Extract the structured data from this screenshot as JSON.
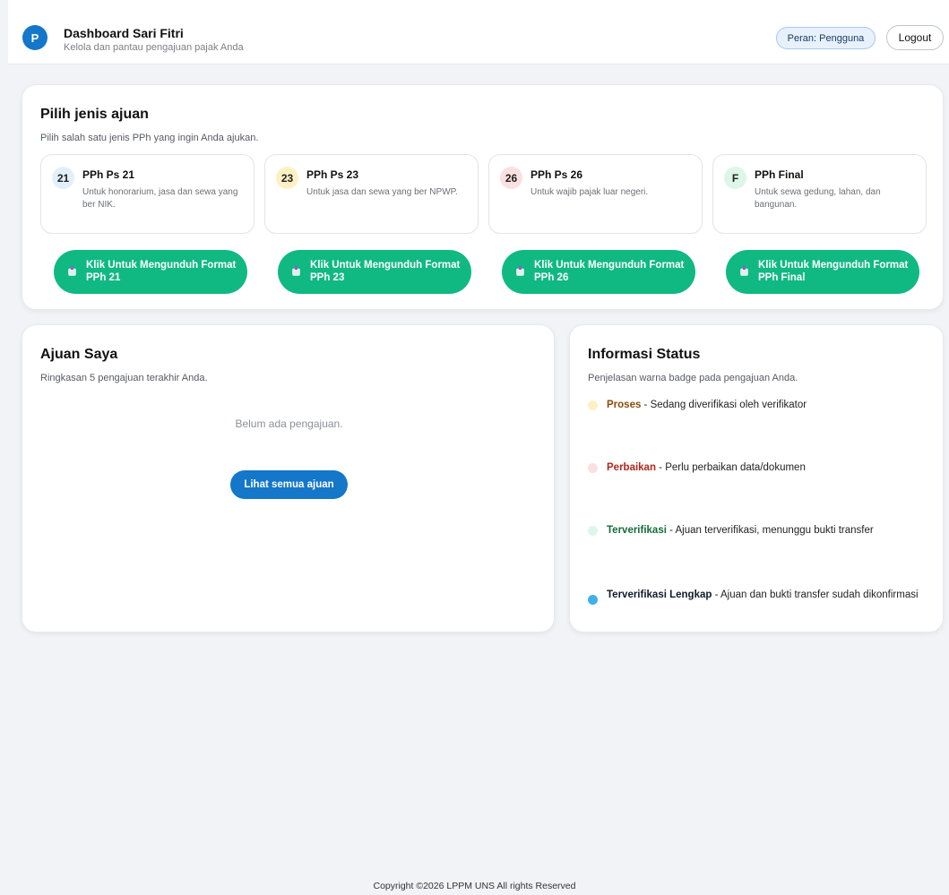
{
  "header": {
    "avatar_letter": "P",
    "title": "Dashboard Sari Fitri",
    "subtitle": "Kelola dan pantau pengajuan pajak Anda",
    "role_badge": "Peran: Pengguna",
    "logout_label": "Logout"
  },
  "pilih": {
    "title": "Pilih jenis ajuan",
    "subtitle": "Pilih salah satu jenis PPh yang ingin Anda ajukan.",
    "types": [
      {
        "badge": "21",
        "name": "PPh Ps 21",
        "desc": "Untuk honorarium, jasa dan sewa yang ber NIK.",
        "badge_color": "#e3f0fb"
      },
      {
        "badge": "23",
        "name": "PPh Ps 23",
        "desc": "Untuk jasa dan sewa yang ber NPWP.",
        "badge_color": "#fdf1c4"
      },
      {
        "badge": "26",
        "name": "PPh Ps 26",
        "desc": "Untuk wajib pajak luar negeri.",
        "badge_color": "#fbe0e0"
      },
      {
        "badge": "F",
        "name": "PPh Final",
        "desc": "Untuk sewa gedung, lahan, dan bangunan.",
        "badge_color": "#ddf6e8"
      }
    ],
    "downloads": [
      {
        "label": "Klik Untuk Mengunduh Format PPh 21",
        "icon": "document-download-icon"
      },
      {
        "label": "Klik Untuk Mengunduh Format PPh 23",
        "icon": "document-download-icon"
      },
      {
        "label": "Klik Untuk Mengunduh Format PPh 26",
        "icon": "document-download-icon"
      },
      {
        "label": "Klik Untuk Mengunduh Format PPh Final",
        "icon": "document-download-icon"
      }
    ],
    "download_color": "#10b981"
  },
  "ajuan": {
    "title": "Ajuan Saya",
    "subtitle": "Ringkasan 5 pengajuan terakhir Anda.",
    "empty_text": "Belum ada pengajuan.",
    "see_all_label": "Lihat semua ajuan"
  },
  "info": {
    "title": "Informasi Status",
    "subtitle": "Penjelasan warna badge pada pengajuan Anda.",
    "statuses": [
      {
        "label": "Proses",
        "desc": " - Sedang diverifikasi oleh verifikator",
        "dot_color": "#fdf1c4",
        "label_color": "#8a4b0a"
      },
      {
        "label": "Perbaikan",
        "desc": " - Perlu perbaikan data/dokumen",
        "dot_color": "#fbe0e0",
        "label_color": "#b3261e"
      },
      {
        "label": "Terverifikasi",
        "desc": " - Ajuan terverifikasi, menunggu bukti transfer",
        "dot_color": "#ddf6e8",
        "label_color": "#156b3a"
      },
      {
        "label": "Terverifikasi Lengkap",
        "desc": " - Ajuan dan bukti transfer sudah dikonfirmasi",
        "dot_color": "#3fb0ea",
        "label_color": "#0d1b2a"
      }
    ]
  },
  "footer": {
    "text": "Copyright ©2026 LPPM UNS All rights Reserved"
  }
}
